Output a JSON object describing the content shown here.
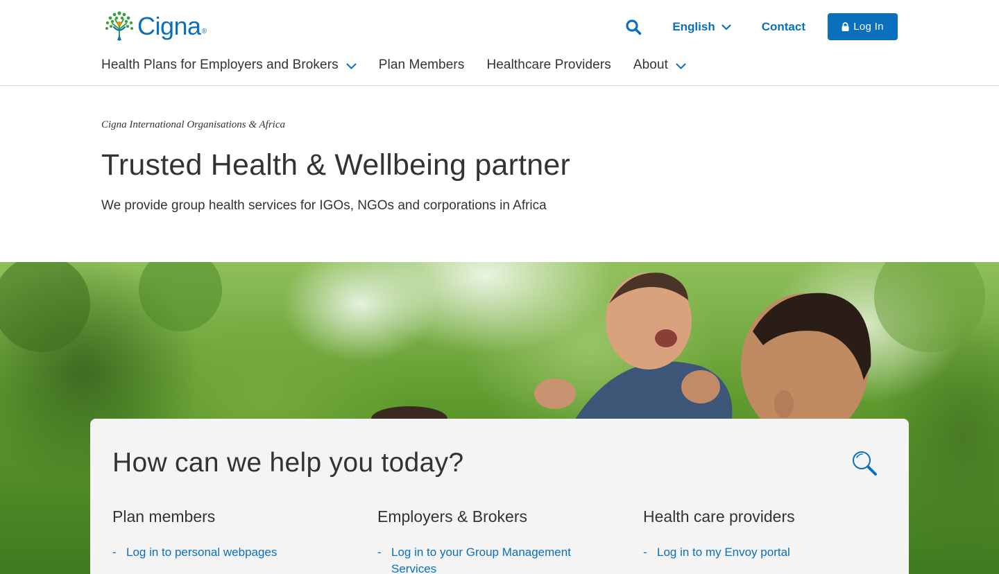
{
  "brand": {
    "name": "Cigna",
    "registered": "®",
    "primary_color": "#0a6fbd",
    "leaf_color": "#35a33b"
  },
  "header": {
    "search_icon": "search-icon",
    "language": "English",
    "contact": "Contact",
    "login": "Log In"
  },
  "nav": {
    "items": [
      {
        "label": "Health Plans for Employers and Brokers",
        "has_dropdown": true
      },
      {
        "label": "Plan Members",
        "has_dropdown": false
      },
      {
        "label": "Healthcare Providers",
        "has_dropdown": false
      },
      {
        "label": "About",
        "has_dropdown": true
      }
    ]
  },
  "intro": {
    "eyebrow": "Cigna International Organisations & Africa",
    "title": "Trusted Health & Wellbeing partner",
    "subtitle": "We provide group health services for IGOs, NGOs and corporations in Africa"
  },
  "help": {
    "title": "How can we help you today?",
    "search_icon": "magnifier-icon",
    "columns": [
      {
        "title": "Plan members",
        "links": [
          "Log in to personal webpages"
        ]
      },
      {
        "title": "Employers & Brokers",
        "links": [
          "Log in to your Group Management Services"
        ]
      },
      {
        "title": "Health care providers",
        "links": [
          "Log in to my Envoy portal"
        ]
      }
    ]
  }
}
